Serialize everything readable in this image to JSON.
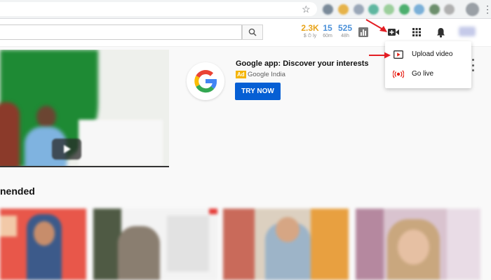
{
  "browser": {
    "star_icon": "star-icon",
    "menu_icon": "kebab-menu-icon"
  },
  "masthead": {
    "search_icon": "search-icon",
    "stats": [
      {
        "value": "2.3K",
        "sub": "$ ⏱ ly",
        "color": "#e8a317"
      },
      {
        "value": "15",
        "sub": "60m",
        "color": "#4a90d9"
      },
      {
        "value": "525",
        "sub": "48h",
        "color": "#4a90d9"
      }
    ],
    "icons": [
      "analytics-icon",
      "create-video-icon",
      "apps-grid-icon",
      "notifications-bell-icon"
    ]
  },
  "ad": {
    "title": "Google app: Discover your interests",
    "badge": "Ad",
    "advertiser": "Google India",
    "cta": "TRY NOW",
    "cta_color": "#065fd4"
  },
  "section": {
    "title": "nended"
  },
  "create_menu": {
    "items": [
      {
        "label": "Upload video",
        "icon": "upload-video-icon"
      },
      {
        "label": "Go live",
        "icon": "go-live-icon"
      }
    ]
  },
  "annotation_color": "#e31e24"
}
